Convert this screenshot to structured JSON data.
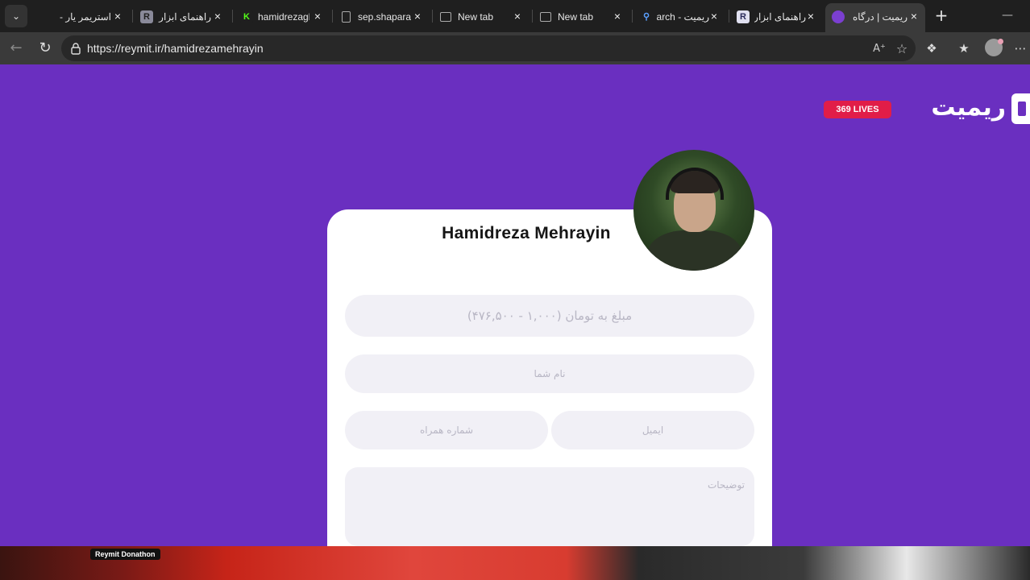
{
  "browser": {
    "tabs": [
      {
        "title": "استریمر یار -",
        "favicon": "",
        "fav_color": "#1f1f1f"
      },
      {
        "title": "راهنمای ابزار",
        "favicon": "R",
        "fav_color": "#8a8a9a"
      },
      {
        "title": "hamidrezagl",
        "favicon": "K",
        "fav_color": "#53fc18"
      },
      {
        "title": "sep.shaparak",
        "favicon": "",
        "fav_color": "#1f1f1f"
      },
      {
        "title": "New tab",
        "favicon": "",
        "fav_color": "#1f1f1f"
      },
      {
        "title": "New tab",
        "favicon": "",
        "fav_color": "#1f1f1f"
      },
      {
        "title": "ریمیت - arch",
        "favicon": "",
        "fav_color": "#1f1f1f"
      },
      {
        "title": "راهنمای ابزار",
        "favicon": "R",
        "fav_color": "#e0e0f0"
      },
      {
        "title": "ریمیت | درگاه",
        "favicon": "",
        "fav_color": "#7b3fd1"
      }
    ],
    "url": "https://reymit.ir/hamidrezamehrayin"
  },
  "header": {
    "logo_text": "ریمیت",
    "live_badge": "369 LIVES"
  },
  "streamer": {
    "name": "Hamidreza Mehrayin"
  },
  "form": {
    "amount_placeholder": "مبلغ به تومان (۱,۰۰۰ - ۴۷۶,۵۰۰)",
    "name_placeholder": "نام شما",
    "email_placeholder": "ایمیل",
    "phone_placeholder": "شماره همراه",
    "description_placeholder": "توضیحات"
  },
  "overlay": {
    "label": "Reymit Donathon"
  },
  "colors": {
    "brand_purple": "#6a2fc0",
    "live_red": "#e11d48"
  }
}
